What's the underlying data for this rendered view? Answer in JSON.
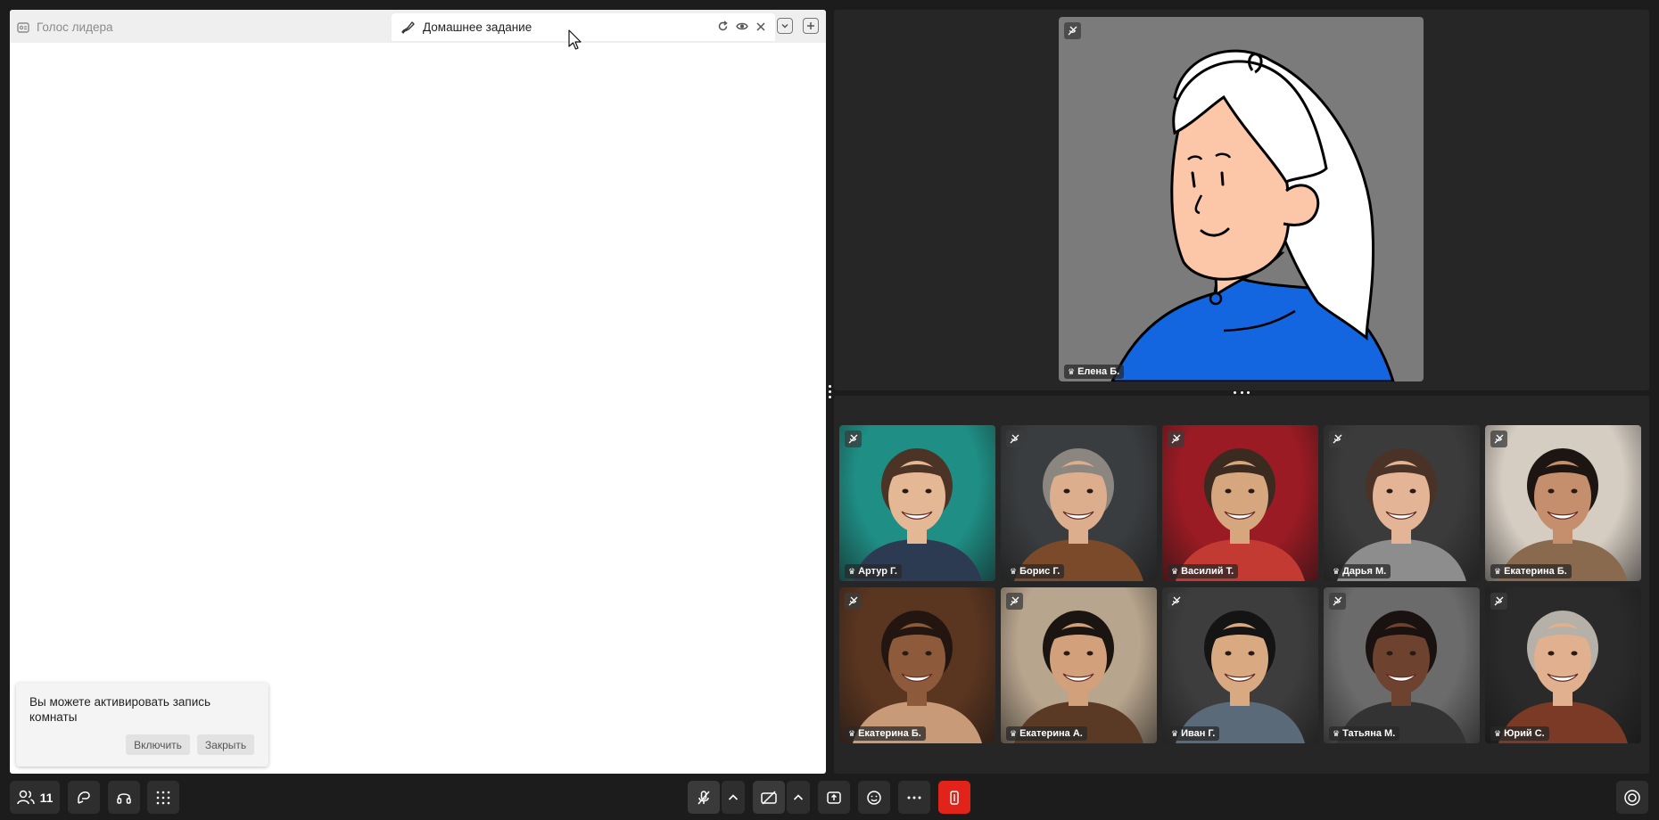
{
  "whiteboard": {
    "tabs": [
      {
        "label": "Голос лидера",
        "active": false,
        "icon": "presentation-icon"
      },
      {
        "label": "Домашнее задание",
        "active": true,
        "icon": "pen-icon"
      }
    ],
    "tab_actions": [
      "refresh-icon",
      "eye-icon",
      "close-icon"
    ],
    "tabbar_buttons": [
      "chevron-down-icon",
      "plus-icon"
    ]
  },
  "toast": {
    "message": "Вы можете активировать запись комнаты",
    "enable_label": "Включить",
    "close_label": "Закрыть"
  },
  "speaker": {
    "name": "Елена Б.",
    "muted": true
  },
  "participants": [
    {
      "name": "Артур Г.",
      "bg": "#1f8f86",
      "skin": "#e5b895",
      "hair": "#4b3325",
      "shirt": "#2c3a52"
    },
    {
      "name": "Борис Г.",
      "bg": "#3a3d3f",
      "skin": "#dcae8e",
      "hair": "#8b8680",
      "shirt": "#7a4a2a"
    },
    {
      "name": "Василий Т.",
      "bg": "#9b1b24",
      "skin": "#d6a67f",
      "hair": "#3b2a20",
      "shirt": "#c23a32"
    },
    {
      "name": "Дарья М.",
      "bg": "#3b3b3b",
      "skin": "#e3b596",
      "hair": "#4a3326",
      "shirt": "#8d8d8d"
    },
    {
      "name": "Екатерина Б.",
      "bg": "#d6cdc2",
      "skin": "#c58e6d",
      "hair": "#1d1512",
      "shirt": "#8a6a4f"
    },
    {
      "name": "Екатерина Б.",
      "bg": "#5a3520",
      "skin": "#8d5a3b",
      "hair": "#231611",
      "shirt": "#c89a78"
    },
    {
      "name": "Екатерина А.",
      "bg": "#b8a58e",
      "skin": "#d3a07c",
      "hair": "#1b1512",
      "shirt": "#5a3a24"
    },
    {
      "name": "Иван Г.",
      "bg": "#3d3d3d",
      "skin": "#d9aa82",
      "hair": "#141414",
      "shirt": "#5a6a78"
    },
    {
      "name": "Татьяна М.",
      "bg": "#6b6b6b",
      "skin": "#6d4330",
      "hair": "#1a1210",
      "shirt": "#333333"
    },
    {
      "name": "Юрий С.",
      "bg": "#2a2a2a",
      "skin": "#e0b08f",
      "hair": "#b5b0a8",
      "shirt": "#7a3a25"
    }
  ],
  "toolbar": {
    "participants_count": "11",
    "left": [
      "people-icon",
      "whiteboard-icon",
      "headset-icon",
      "apps-grid-icon"
    ],
    "center": [
      "mic-off-icon",
      "chevron-up-icon",
      "camera-off-icon",
      "chevron-up-icon",
      "share-screen-icon",
      "emoji-icon",
      "more-icon",
      "leave-icon"
    ],
    "right": [
      "record-icon"
    ]
  },
  "colors": {
    "background": "#1c1c1c",
    "panel": "#262626",
    "leave_red": "#e2231a",
    "speaker_tile": "#7b7b7b",
    "speaker_shirt": "#1466e0"
  }
}
